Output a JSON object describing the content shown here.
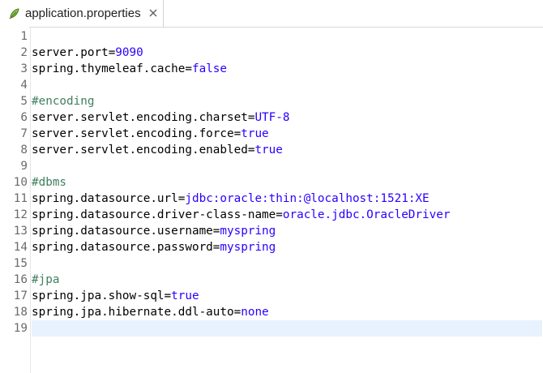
{
  "tab": {
    "title": "application.properties",
    "icon": "properties-file-icon"
  },
  "colors": {
    "key": "#000000",
    "value": "#2a00ff",
    "comment": "#3f7f5f",
    "line_number": "#6b6b6b",
    "current_line": "#e8f2fe"
  },
  "editor": {
    "current_line": 19,
    "lines": [
      {
        "n": "1",
        "type": "blank"
      },
      {
        "n": "2",
        "type": "prop",
        "key": "server.port",
        "value": "9090"
      },
      {
        "n": "3",
        "type": "prop",
        "key": "spring.thymeleaf.cache",
        "value": "false"
      },
      {
        "n": "4",
        "type": "blank"
      },
      {
        "n": "5",
        "type": "comment",
        "text": "#encoding"
      },
      {
        "n": "6",
        "type": "prop",
        "key": "server.servlet.encoding.charset",
        "value": "UTF-8"
      },
      {
        "n": "7",
        "type": "prop",
        "key": "server.servlet.encoding.force",
        "value": "true"
      },
      {
        "n": "8",
        "type": "prop",
        "key": "server.servlet.encoding.enabled",
        "value": "true"
      },
      {
        "n": "9",
        "type": "blank"
      },
      {
        "n": "10",
        "type": "comment",
        "text": "#dbms"
      },
      {
        "n": "11",
        "type": "prop",
        "key": "spring.datasource.url",
        "value": "jdbc:oracle:thin:@localhost:1521:XE"
      },
      {
        "n": "12",
        "type": "prop",
        "key": "spring.datasource.driver-class-name",
        "value": "oracle.jdbc.OracleDriver"
      },
      {
        "n": "13",
        "type": "prop",
        "key": "spring.datasource.username",
        "value": "myspring"
      },
      {
        "n": "14",
        "type": "prop",
        "key": "spring.datasource.password",
        "value": "myspring"
      },
      {
        "n": "15",
        "type": "blank"
      },
      {
        "n": "16",
        "type": "comment",
        "text": "#jpa"
      },
      {
        "n": "17",
        "type": "prop",
        "key": "spring.jpa.show-sql",
        "value": "true"
      },
      {
        "n": "18",
        "type": "prop",
        "key": "spring.jpa.hibernate.ddl-auto",
        "value": "none"
      },
      {
        "n": "19",
        "type": "blank"
      }
    ]
  }
}
